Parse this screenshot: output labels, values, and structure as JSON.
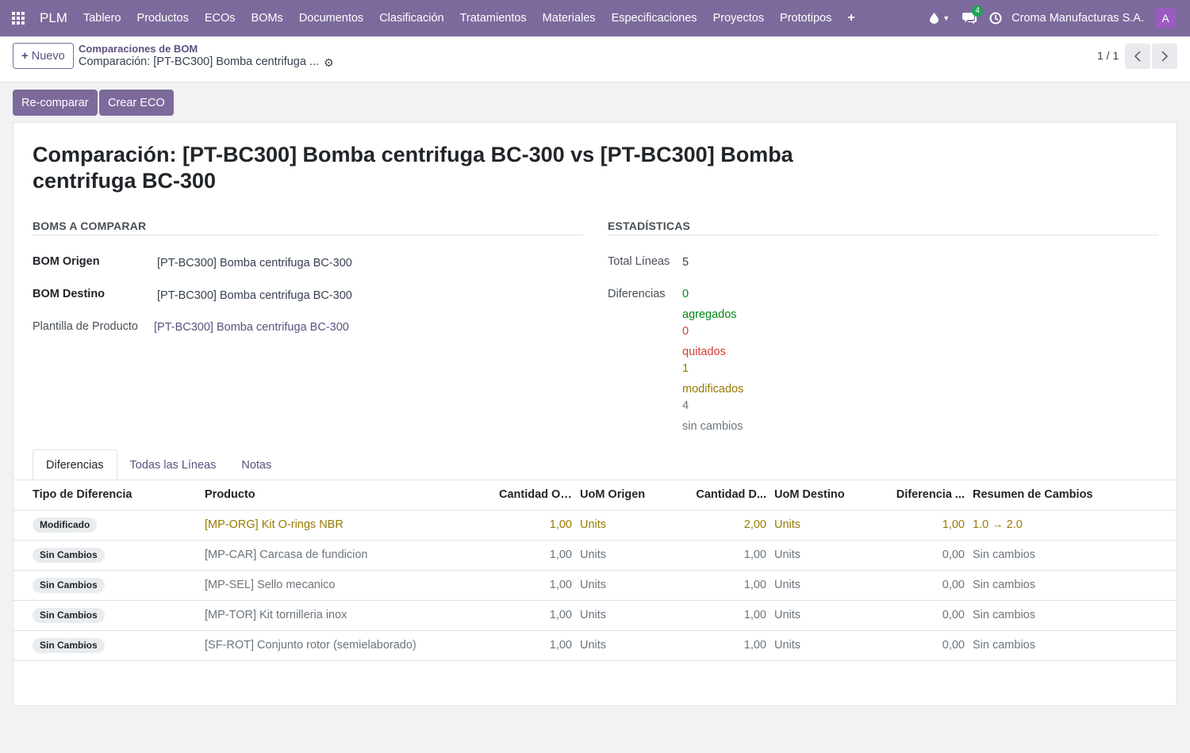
{
  "navbar": {
    "brand": "PLM",
    "menu": [
      "Tablero",
      "Productos",
      "ECOs",
      "BOMs",
      "Documentos",
      "Clasificación",
      "Tratamientos",
      "Materiales",
      "Especificaciones",
      "Proyectos",
      "Prototipos"
    ],
    "plus": "+",
    "chat_count": "4",
    "company": "Croma Manufacturas S.A.",
    "avatar": "A",
    "accent": "#7c6a9c"
  },
  "control": {
    "new_label": "Nuevo",
    "breadcrumb_parent": "Comparaciones de BOM",
    "breadcrumb_current": "Comparación: [PT-BC300] Bomba centrifuga ...",
    "pager": "1 / 1"
  },
  "actions": {
    "recompare": "Re-comparar",
    "create_eco": "Crear ECO"
  },
  "form": {
    "title": "Comparación: [PT-BC300] Bomba centrifuga BC-300 vs [PT-BC300] Bomba centrifuga BC-300",
    "section_boms": "BOMS A COMPARAR",
    "section_stats": "ESTADÍSTICAS",
    "bom_origen_label": "BOM Origen",
    "bom_origen_value": "[PT-BC300] Bomba centrifuga BC-300",
    "bom_destino_label": "BOM Destino",
    "bom_destino_value": "[PT-BC300] Bomba centrifuga BC-300",
    "plantilla_label": "Plantilla de Producto",
    "plantilla_value": "[PT-BC300] Bomba centrifuga BC-300",
    "total_lineas_label": "Total Líneas",
    "total_lineas_value": "5",
    "diferencias_label": "Diferencias",
    "added_count": "0",
    "added_label": "agregados",
    "removed_count": "0",
    "removed_label": "quitados",
    "modified_count": "1",
    "modified_label": "modificados",
    "unchanged_count": "4",
    "unchanged_label": "sin cambios"
  },
  "tabs": [
    "Diferencias",
    "Todas las Líneas",
    "Notas"
  ],
  "table": {
    "headers": [
      "Tipo de Diferencia",
      "Producto",
      "Cantidad Or...",
      "UoM Origen",
      "Cantidad D...",
      "UoM Destino",
      "Diferencia ...",
      "Resumen de Cambios"
    ],
    "rows": [
      {
        "tipo": "Modificado",
        "producto": "[MP-ORG] Kit O-rings NBR",
        "cant_origen": "1,00",
        "uom_origen": "Units",
        "cant_destino": "2,00",
        "uom_destino": "Units",
        "diferencia": "1,00",
        "resumen": "1.0 → 2.0"
      },
      {
        "tipo": "Sin Cambios",
        "producto": "[MP-CAR] Carcasa de fundicion",
        "cant_origen": "1,00",
        "uom_origen": "Units",
        "cant_destino": "1,00",
        "uom_destino": "Units",
        "diferencia": "0,00",
        "resumen": "Sin cambios"
      },
      {
        "tipo": "Sin Cambios",
        "producto": "[MP-SEL] Sello mecanico",
        "cant_origen": "1,00",
        "uom_origen": "Units",
        "cant_destino": "1,00",
        "uom_destino": "Units",
        "diferencia": "0,00",
        "resumen": "Sin cambios"
      },
      {
        "tipo": "Sin Cambios",
        "producto": "[MP-TOR] Kit tornilleria inox",
        "cant_origen": "1,00",
        "uom_origen": "Units",
        "cant_destino": "1,00",
        "uom_destino": "Units",
        "diferencia": "0,00",
        "resumen": "Sin cambios"
      },
      {
        "tipo": "Sin Cambios",
        "producto": "[SF-ROT] Conjunto rotor (semielaborado)",
        "cant_origen": "1,00",
        "uom_origen": "Units",
        "cant_destino": "1,00",
        "uom_destino": "Units",
        "diferencia": "0,00",
        "resumen": "Sin cambios"
      }
    ]
  },
  "colors": {
    "added": "#008818",
    "removed": "#d23f3a",
    "modified": "#9a7a00",
    "unchanged": "#6c757d"
  }
}
